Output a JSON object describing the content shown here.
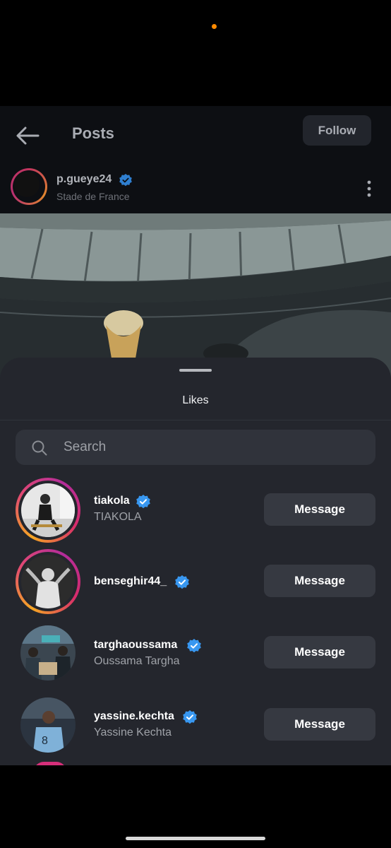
{
  "header": {
    "title": "Posts",
    "follow_label": "Follow"
  },
  "post": {
    "author": "p.gueye24",
    "location": "Stade de France"
  },
  "likes_sheet": {
    "title": "Likes",
    "search_placeholder": "Search",
    "message_label": "Message",
    "users": [
      {
        "username": "tiakola",
        "full_name": "TIAKOLA",
        "verified": true
      },
      {
        "username": "benseghir44_",
        "full_name": "",
        "verified": true
      },
      {
        "username": "targhaoussama",
        "full_name": "Oussama Targha",
        "verified": true
      },
      {
        "username": "yassine.kechta",
        "full_name": "Yassine Kechta",
        "verified": true
      }
    ]
  },
  "colors": {
    "accent_verified": "#3897f0",
    "story_ring_start": "#f5a623",
    "story_ring_end": "#b32c9a",
    "sheet_background": "#24262d",
    "status_dot": "#ff8a00"
  },
  "icons": [
    "back-arrow-icon",
    "verified-icon",
    "more-vertical-icon",
    "search-icon"
  ]
}
